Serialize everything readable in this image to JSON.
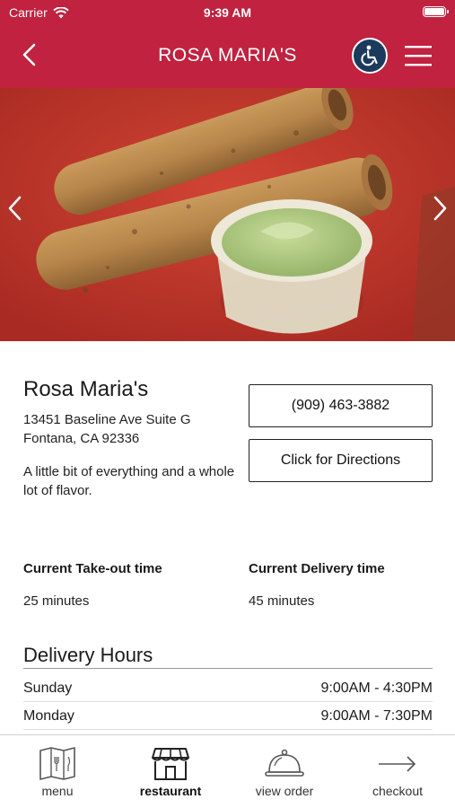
{
  "status_bar": {
    "carrier": "Carrier",
    "time": "9:39 AM"
  },
  "header": {
    "title": "ROSA MARIA'S",
    "accent_color": "#c0223f"
  },
  "restaurant": {
    "name": "Rosa Maria's",
    "address_line1": "13451 Baseline Ave Suite G",
    "address_line2": "Fontana, CA 92336",
    "tagline": "A little bit of everything and a whole lot of flavor.",
    "phone": "(909) 463-3882",
    "directions_label": "Click for Directions"
  },
  "times": {
    "takeout_label": "Current Take-out time",
    "takeout_value": "25 minutes",
    "delivery_label": "Current Delivery time",
    "delivery_value": "45 minutes"
  },
  "delivery_hours": {
    "title": "Delivery Hours",
    "rows": [
      {
        "day": "Sunday",
        "hours": "9:00AM - 4:30PM"
      },
      {
        "day": "Monday",
        "hours": "9:00AM - 7:30PM"
      }
    ]
  },
  "tabbar": {
    "tabs": [
      {
        "label": "menu",
        "icon": "menu-book-icon"
      },
      {
        "label": "restaurant",
        "icon": "storefront-icon",
        "active": true
      },
      {
        "label": "view order",
        "icon": "cloche-icon"
      },
      {
        "label": "checkout",
        "icon": "arrow-right-icon"
      }
    ]
  }
}
